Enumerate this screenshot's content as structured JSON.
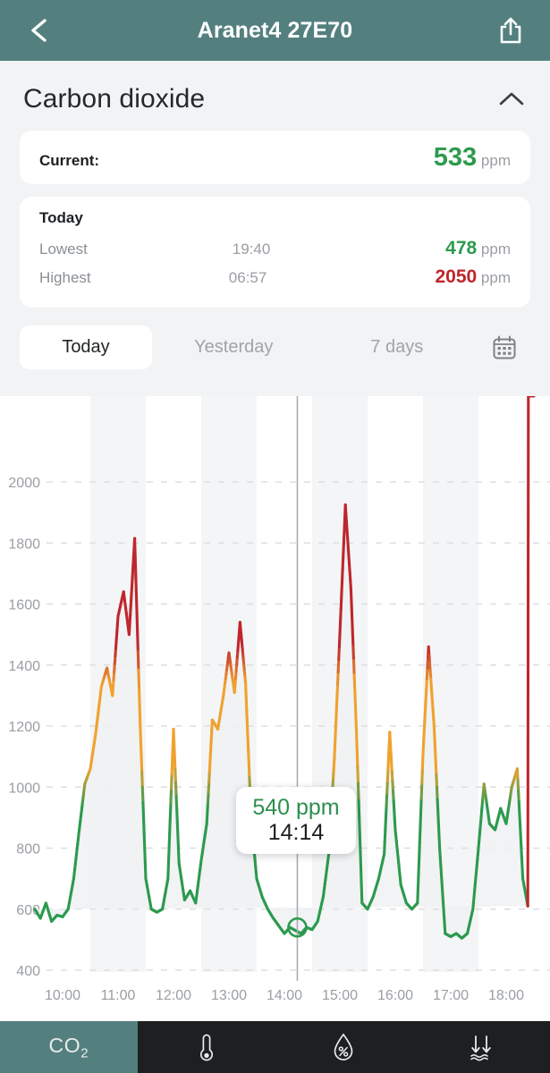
{
  "header": {
    "back_icon": "chevron-left-icon",
    "title": "Aranet4 27E70",
    "share_icon": "share-icon"
  },
  "panel": {
    "title": "Carbon dioxide",
    "collapse_icon": "chevron-up-icon",
    "current": {
      "label": "Current:",
      "value": "533",
      "unit": "ppm"
    },
    "today": {
      "label": "Today",
      "rows": [
        {
          "label": "Lowest",
          "time": "19:40",
          "value": "478",
          "unit": "ppm",
          "color": "#2d9a4e"
        },
        {
          "label": "Highest",
          "time": "06:57",
          "value": "2050",
          "unit": "ppm",
          "color": "#bf262c"
        }
      ]
    }
  },
  "tabs": {
    "items": [
      {
        "label": "Today",
        "active": true
      },
      {
        "label": "Yesterday",
        "active": false
      },
      {
        "label": "7 days",
        "active": false
      }
    ],
    "calendar_icon": "calendar-icon"
  },
  "tooltip": {
    "value": "540 ppm",
    "time": "14:14"
  },
  "bottom_nav": {
    "items": [
      {
        "label": "CO2",
        "icon": "co2-icon",
        "active": true
      },
      {
        "label": "",
        "icon": "thermometer-icon",
        "active": false
      },
      {
        "label": "",
        "icon": "humidity-drop-icon",
        "active": false
      },
      {
        "label": "",
        "icon": "pressure-arrows-icon",
        "active": false
      }
    ]
  },
  "colors": {
    "accent_teal": "#53807f",
    "green": "#2d9a4e",
    "orange": "#f0a22e",
    "red": "#bf262c",
    "panel_bg": "#f2f3f5",
    "nav_bg": "#1d1f20"
  },
  "chart_data": {
    "type": "line",
    "title": "Carbon dioxide — Today",
    "xlabel": "",
    "ylabel": "ppm",
    "ylim": [
      400,
      2000
    ],
    "ytick_values": [
      400,
      600,
      800,
      1000,
      1200,
      1400,
      1600,
      1800,
      2000
    ],
    "xtick_labels": [
      "10:00",
      "11:00",
      "12:00",
      "13:00",
      "14:00",
      "15:00",
      "16:00",
      "17:00",
      "18:00"
    ],
    "grid": "horizontal-dashed",
    "legend": "none",
    "thresholds": {
      "green_max": 1000,
      "orange_max": 1400,
      "red_above": 1400
    },
    "cursor": {
      "time": "14:14",
      "value": 540
    },
    "series": [
      {
        "name": "CO2",
        "x": [
          "09:30",
          "09:36",
          "09:42",
          "09:48",
          "09:54",
          "10:00",
          "10:06",
          "10:12",
          "10:18",
          "10:24",
          "10:30",
          "10:36",
          "10:42",
          "10:48",
          "10:54",
          "11:00",
          "11:06",
          "11:12",
          "11:18",
          "11:24",
          "11:30",
          "11:36",
          "11:42",
          "11:48",
          "11:54",
          "12:00",
          "12:06",
          "12:12",
          "12:18",
          "12:24",
          "12:30",
          "12:36",
          "12:42",
          "12:48",
          "12:54",
          "13:00",
          "13:06",
          "13:12",
          "13:18",
          "13:24",
          "13:30",
          "13:36",
          "13:42",
          "13:48",
          "13:54",
          "14:00",
          "14:06",
          "14:12",
          "14:18",
          "14:24",
          "14:30",
          "14:36",
          "14:42",
          "14:48",
          "14:54",
          "15:00",
          "15:06",
          "15:12",
          "15:18",
          "15:24",
          "15:30",
          "15:36",
          "15:42",
          "15:48",
          "15:54",
          "16:00",
          "16:06",
          "16:12",
          "16:18",
          "16:24",
          "16:30",
          "16:36",
          "16:42",
          "16:48",
          "16:54",
          "17:00",
          "17:06",
          "17:12",
          "17:18",
          "17:24",
          "17:30",
          "17:36",
          "17:42",
          "17:48",
          "17:54",
          "18:00",
          "18:06",
          "18:12",
          "18:18",
          "18:24",
          "18:30"
        ],
        "values": [
          600,
          570,
          620,
          560,
          580,
          575,
          600,
          700,
          860,
          1010,
          1060,
          1180,
          1330,
          1390,
          1300,
          1560,
          1640,
          1500,
          1815,
          1200,
          700,
          600,
          590,
          600,
          700,
          1190,
          750,
          630,
          660,
          620,
          760,
          880,
          1220,
          1190,
          1300,
          1440,
          1310,
          1540,
          1340,
          900,
          700,
          640,
          600,
          570,
          545,
          520,
          540,
          530,
          520,
          540,
          533,
          560,
          640,
          780,
          1090,
          1500,
          1925,
          1650,
          1180,
          620,
          600,
          640,
          700,
          780,
          1180,
          860,
          680,
          620,
          600,
          620,
          1110,
          1460,
          1200,
          800,
          520,
          510,
          520,
          505,
          520,
          600,
          800,
          1010,
          880,
          860,
          930,
          880,
          1000,
          1060,
          700,
          600
        ]
      }
    ]
  }
}
